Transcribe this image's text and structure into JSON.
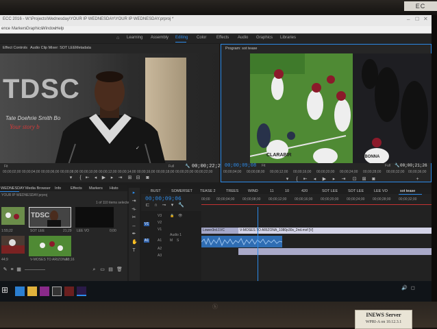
{
  "monitor": {
    "brand_tag": "EC",
    "sticker": {
      "title": "INEWS Server",
      "sub": "WPRI-A on 10.12.3.1"
    }
  },
  "app": {
    "title": "ЕСС 2016 - W:\\Projects\\Wednesday\\YOUR IP WEDNESDAY\\YOUR IP WEDNESDAY.prproj *",
    "menu": [
      "ence",
      "Markers",
      "Graphics",
      "Window",
      "Help"
    ],
    "workspaces": [
      "Learning",
      "Assembly",
      "Editing",
      "Color",
      "Effects",
      "Audio",
      "Graphics",
      "Libraries"
    ],
    "active_workspace": "Editing",
    "accent": "#2d8ceb"
  },
  "source_panel": {
    "tabs": [
      "Effect Controls",
      "Audio Clip Mixer: SOT LEE",
      "Metadata"
    ],
    "logo_text": "TDSC",
    "logo_line1": "Tate Doehrie Smith Bo",
    "logo_line2": "Your story b",
    "fit": "Fit",
    "quality": "Full",
    "timecode_right": "00;00;22;24",
    "ruler": [
      "00;00;02;00",
      "00;00;04;00",
      "00;00;06;00",
      "00;00;08;00",
      "00;00;10;00",
      "00;00;12;00",
      "00;00;14;00",
      "00;00;16;00",
      "00;00;18;00",
      "00;00;20;00",
      "00;00;22;00"
    ]
  },
  "program_panel": {
    "title": "Program: sot tease",
    "timecode_left": "00;00;09;08",
    "fit": "Fit",
    "quality": "Full",
    "timecode_right": "00;00;21;26",
    "ruler": [
      "00;00;04;00",
      "00;00;08;00",
      "00;00;12;00",
      "00;00;16;00",
      "00;00;20;00",
      "00;00;24;00",
      "00;00;28;00",
      "00;00;32;00",
      "00;00;36;00"
    ],
    "jersey_name": "CLARABIR",
    "jersey_name2": "OGBONNA"
  },
  "project_panel": {
    "tabs": [
      "WEDNESDAY",
      "Media Browser",
      "Info",
      "Effects",
      "Markers",
      "Histo"
    ],
    "project_file": "YOUR IP WEDNESDAY.prproj",
    "selection": "1 of 110 items selected",
    "items": [
      {
        "name": "1:55;22",
        "duration": ""
      },
      {
        "name": "SOT LEE",
        "duration": "21;29"
      },
      {
        "name": "LEE VO",
        "duration": "0;00"
      },
      {
        "name": "",
        "duration": ""
      },
      {
        "name": "V-MOSES TO ARIZONA",
        "duration": "38;16"
      }
    ],
    "counts": [
      "44;9"
    ]
  },
  "timeline_panel": {
    "tabs": [
      "BUST",
      "SOMERSET",
      "TEASE 2",
      "TREES",
      "WIND",
      "11",
      "10",
      "420",
      "SOT LEE",
      "SOT LEE",
      "LEE VO",
      "sot tease"
    ],
    "active_tab": "sot tease",
    "timecode": "00;00;09;06",
    "ruler": [
      "00;00",
      "00;00;04;00",
      "00;00;08;00",
      "00;00;12;00",
      "00;00;16;00",
      "00;00;20;00",
      "00;00;24;00",
      "00;00;28;00",
      "00;00;32;00"
    ],
    "track_labels": [
      "V3",
      "V2",
      "V1",
      "A1",
      "A2",
      "A3"
    ],
    "clip_v1": "Lower3rd.1VC",
    "clip_v2": "V-MOSES TO ARIZONA_1080p30s_2nd.mxf [V]",
    "clip_a1_label": "Audio 1"
  }
}
